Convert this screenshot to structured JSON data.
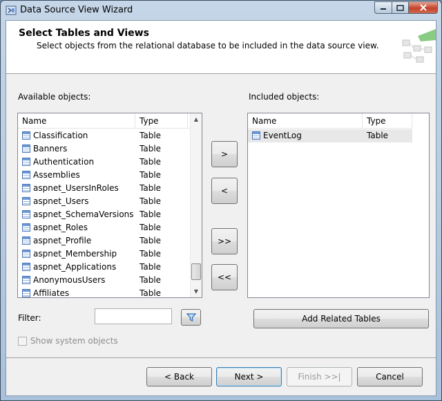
{
  "window": {
    "title": "Data Source View Wizard"
  },
  "header": {
    "title": "Select Tables and Views",
    "subtitle": "Select objects from the relational database to be included in the data source view."
  },
  "available": {
    "label": "Available objects:",
    "columns": {
      "name": "Name",
      "type": "Type"
    },
    "rows": [
      {
        "name": "Classification",
        "type": "Table"
      },
      {
        "name": "Banners",
        "type": "Table"
      },
      {
        "name": "Authentication",
        "type": "Table"
      },
      {
        "name": "Assemblies",
        "type": "Table"
      },
      {
        "name": "aspnet_UsersInRoles",
        "type": "Table"
      },
      {
        "name": "aspnet_Users",
        "type": "Table"
      },
      {
        "name": "aspnet_SchemaVersions",
        "type": "Table"
      },
      {
        "name": "aspnet_Roles",
        "type": "Table"
      },
      {
        "name": "aspnet_Profile",
        "type": "Table"
      },
      {
        "name": "aspnet_Membership",
        "type": "Table"
      },
      {
        "name": "aspnet_Applications",
        "type": "Table"
      },
      {
        "name": "AnonymousUsers",
        "type": "Table"
      },
      {
        "name": "Affiliates",
        "type": "Table"
      }
    ]
  },
  "included": {
    "label": "Included objects:",
    "columns": {
      "name": "Name",
      "type": "Type"
    },
    "rows": [
      {
        "name": "EventLog",
        "type": "Table"
      }
    ]
  },
  "move_buttons": {
    "add": ">",
    "remove": "<",
    "add_all": ">>",
    "remove_all": "<<"
  },
  "filter": {
    "label": "Filter:",
    "value": ""
  },
  "show_system_objects": {
    "label": "Show system objects",
    "checked": false
  },
  "add_related_label": "Add Related Tables",
  "footer": {
    "back": "< Back",
    "next": "Next >",
    "finish": "Finish >>|",
    "cancel": "Cancel"
  },
  "colors": {
    "table_icon": "#4a76b8",
    "filter_icon": "#2d6fb5"
  }
}
